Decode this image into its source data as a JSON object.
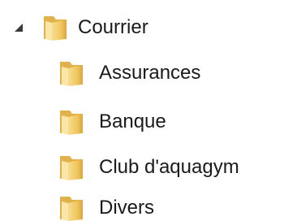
{
  "tree": {
    "root": {
      "label": "Courrier",
      "expanded": true,
      "icon": "folder-icon"
    },
    "children": [
      {
        "label": "Assurances",
        "icon": "folder-icon"
      },
      {
        "label": "Banque",
        "icon": "folder-icon"
      },
      {
        "label": "Club d'aquagym",
        "icon": "folder-icon"
      },
      {
        "label": "Divers",
        "icon": "folder-icon"
      }
    ]
  },
  "colors": {
    "folder_light": "#f5d47a",
    "folder_dark": "#d9a73e",
    "expander": "#3a3a3a"
  }
}
